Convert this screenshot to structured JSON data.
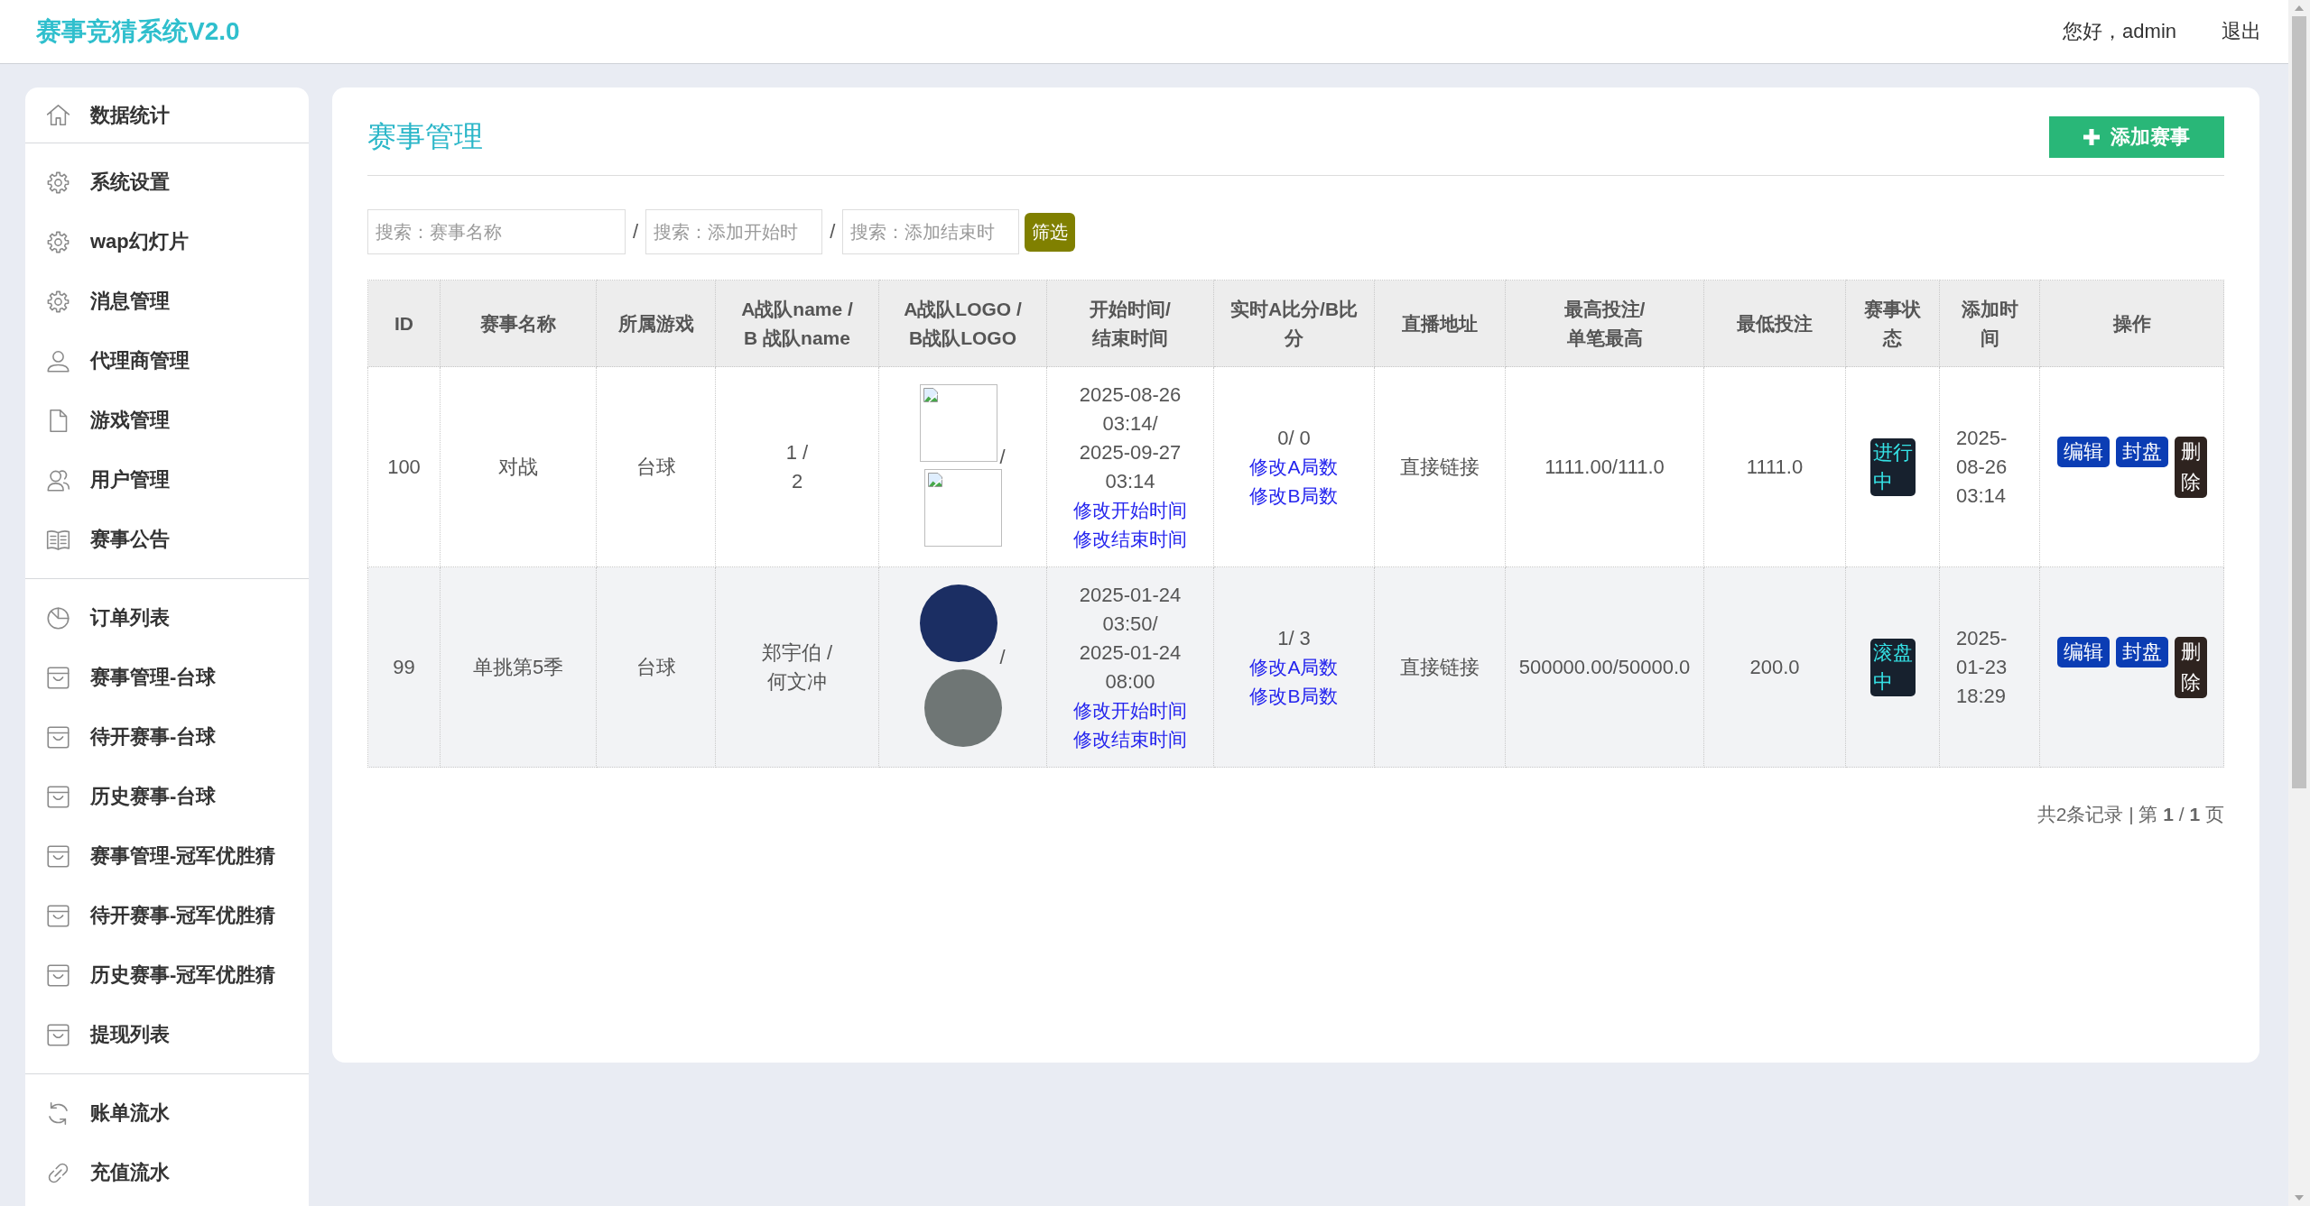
{
  "header": {
    "logo": "赛事竞猜系统V2.0",
    "greeting": "您好，admin",
    "logout": "退出"
  },
  "sidebar": {
    "groups": [
      {
        "items": [
          {
            "label": "数据统计"
          }
        ]
      },
      {
        "items": [
          {
            "label": "系统设置"
          },
          {
            "label": "wap幻灯片"
          },
          {
            "label": "消息管理"
          },
          {
            "label": "代理商管理"
          },
          {
            "label": "游戏管理"
          },
          {
            "label": "用户管理"
          },
          {
            "label": "赛事公告"
          }
        ]
      },
      {
        "items": [
          {
            "label": "订单列表"
          },
          {
            "label": "赛事管理-台球"
          },
          {
            "label": "待开赛事-台球"
          },
          {
            "label": "历史赛事-台球"
          },
          {
            "label": "赛事管理-冠军优胜猜"
          },
          {
            "label": "待开赛事-冠军优胜猜"
          },
          {
            "label": "历史赛事-冠军优胜猜"
          },
          {
            "label": "提现列表"
          }
        ]
      },
      {
        "items": [
          {
            "label": "账单流水"
          },
          {
            "label": "充值流水"
          }
        ]
      }
    ]
  },
  "panel": {
    "title": "赛事管理",
    "add_button": "添加赛事",
    "filters": [
      {
        "kind": "field",
        "placeholder": "搜索：赛事名称"
      },
      {
        "kind": "separator",
        "text": "/"
      },
      {
        "kind": "field",
        "placeholder": "搜索：添加开始时"
      },
      {
        "kind": "separator",
        "text": "/"
      },
      {
        "kind": "field",
        "placeholder": "搜索：添加结束时"
      },
      {
        "kind": "button",
        "label": "筛选"
      }
    ],
    "table": {
      "columns": [
        {
          "lines": [
            "ID"
          ]
        },
        {
          "lines": [
            "赛事名称"
          ]
        },
        {
          "lines": [
            "所属游戏"
          ]
        },
        {
          "lines": [
            "A战队name /",
            "B 战队name"
          ]
        },
        {
          "lines": [
            "A战队LOGO /",
            "B战队LOGO"
          ]
        },
        {
          "lines": [
            "开始时间/",
            "结束时间"
          ]
        },
        {
          "lines": [
            "实时A比分/B比",
            "分"
          ]
        },
        {
          "lines": [
            "直播地址"
          ]
        },
        {
          "lines": [
            "最高投注/",
            "单笔最高"
          ]
        },
        {
          "lines": [
            "最低投注"
          ]
        },
        {
          "lines": [
            "赛事状",
            "态"
          ]
        },
        {
          "lines": [
            "添加时",
            "间"
          ]
        },
        {
          "lines": [
            "操作"
          ]
        }
      ],
      "rows": [
        {
          "id": "100",
          "name": "对战",
          "game": "台球",
          "teams": [
            "1 /",
            "2"
          ],
          "logos": [
            {
              "kind": "broken"
            },
            {
              "kind": "broken"
            }
          ],
          "logo_separator": "/",
          "start_time": "2025-08-26 03:14/",
          "end_time": "2025-09-27 03:14",
          "time_links": [
            "修改开始时间",
            "修改结束时间"
          ],
          "score": "0/ 0",
          "score_links": [
            "修改A局数",
            "修改B局数"
          ],
          "stream": "直接链接",
          "max_bet": "1111.00/111.0",
          "min_bet": "1111.0",
          "status": "进行中",
          "added": "2025-08-26 03:14",
          "actions": [
            {
              "label": "编辑",
              "kind": "primary"
            },
            {
              "label": "封盘",
              "kind": "primary"
            },
            {
              "label": "删除",
              "kind": "danger"
            }
          ]
        },
        {
          "id": "99",
          "name": "单挑第5季",
          "game": "台球",
          "teams": [
            "郑宇伯 /",
            "何文冲"
          ],
          "logos": [
            {
              "kind": "photo"
            },
            {
              "kind": "photo"
            }
          ],
          "logo_separator": "/",
          "start_time": "2025-01-24 03:50/",
          "end_time": "2025-01-24 08:00",
          "time_links": [
            "修改开始时间",
            "修改结束时间"
          ],
          "score": "1/ 3",
          "score_links": [
            "修改A局数",
            "修改B局数"
          ],
          "stream": "直接链接",
          "max_bet": "500000.00/50000.0",
          "min_bet": "200.0",
          "status": "滚盘中",
          "added": "2025-01-23 18:29",
          "actions": [
            {
              "label": "编辑",
              "kind": "primary"
            },
            {
              "label": "封盘",
              "kind": "primary"
            },
            {
              "label": "删除",
              "kind": "danger"
            }
          ]
        }
      ]
    },
    "pagination": "共2条记录 | 第 **1** / **1** 页"
  }
}
